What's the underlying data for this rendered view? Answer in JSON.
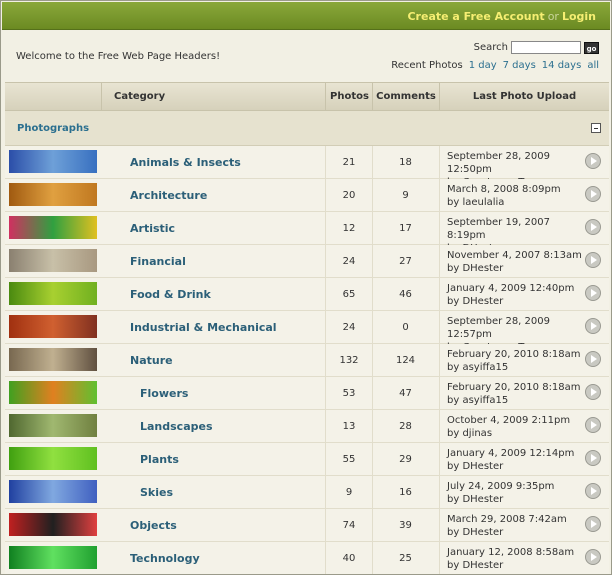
{
  "topbar": {
    "create_account": "Create a Free Account",
    "or": "or",
    "login": "Login"
  },
  "welcome": "Welcome to the Free Web Page Headers!",
  "search": {
    "label": "Search",
    "value": "",
    "go": "go"
  },
  "recent": {
    "label": "Recent Photos",
    "links": [
      "1 day",
      "7 days",
      "14 days",
      "all"
    ]
  },
  "table": {
    "headers": {
      "category": "Category",
      "photos": "Photos",
      "comments": "Comments",
      "last": "Last Photo Upload"
    },
    "section": "Photographs",
    "rows": [
      {
        "name": "Animals & Insects",
        "sub": false,
        "photos": "21",
        "comments": "18",
        "date": "September 28, 2009 12:50pm",
        "by": "by Constance Tang",
        "thumb": [
          "#2b4ea8",
          "#6ea0d8",
          "#3870c0"
        ]
      },
      {
        "name": "Architecture",
        "sub": false,
        "photos": "20",
        "comments": "9",
        "date": "March 8, 2008 8:09pm",
        "by": "by laeulalia",
        "thumb": [
          "#a05a10",
          "#e0a040",
          "#c07820"
        ]
      },
      {
        "name": "Artistic",
        "sub": false,
        "photos": "12",
        "comments": "17",
        "date": "September 19, 2007 8:19pm",
        "by": "by DHester",
        "thumb": [
          "#d03060",
          "#30a040",
          "#e0c020"
        ]
      },
      {
        "name": "Financial",
        "sub": false,
        "photos": "24",
        "comments": "27",
        "date": "November 4, 2007 8:13am",
        "by": "by DHester",
        "thumb": [
          "#8a8070",
          "#c8c0a8",
          "#a89880"
        ]
      },
      {
        "name": "Food & Drink",
        "sub": false,
        "photos": "65",
        "comments": "46",
        "date": "January 4, 2009 12:40pm",
        "by": "by DHester",
        "thumb": [
          "#4a8a10",
          "#a8d030",
          "#70b020"
        ]
      },
      {
        "name": "Industrial & Mechanical",
        "sub": false,
        "photos": "24",
        "comments": "0",
        "date": "September 28, 2009 12:57pm",
        "by": "by Constance Tang",
        "thumb": [
          "#a03010",
          "#d06030",
          "#803020"
        ]
      },
      {
        "name": "Nature",
        "sub": false,
        "photos": "132",
        "comments": "124",
        "date": "February 20, 2010 8:18am",
        "by": "by asyiffa15",
        "thumb": [
          "#786850",
          "#c0b090",
          "#605040"
        ]
      },
      {
        "name": "Flowers",
        "sub": true,
        "photos": "53",
        "comments": "47",
        "date": "February 20, 2010 8:18am",
        "by": "by asyiffa15",
        "thumb": [
          "#40a020",
          "#e08020",
          "#60c030"
        ]
      },
      {
        "name": "Landscapes",
        "sub": true,
        "photos": "13",
        "comments": "28",
        "date": "October 4, 2009 2:11pm",
        "by": "by djinas",
        "thumb": [
          "#506830",
          "#a0b870",
          "#708040"
        ]
      },
      {
        "name": "Plants",
        "sub": true,
        "photos": "55",
        "comments": "29",
        "date": "January 4, 2009 12:14pm",
        "by": "by DHester",
        "thumb": [
          "#40a010",
          "#90e040",
          "#60c020"
        ]
      },
      {
        "name": "Skies",
        "sub": true,
        "photos": "9",
        "comments": "16",
        "date": "July 24, 2009 9:35pm",
        "by": "by DHester",
        "thumb": [
          "#2040a0",
          "#80a8e0",
          "#4060c0"
        ]
      },
      {
        "name": "Objects",
        "sub": false,
        "photos": "74",
        "comments": "39",
        "date": "March 29, 2008 7:42am",
        "by": "by DHester",
        "thumb": [
          "#c02020",
          "#202020",
          "#e04040"
        ]
      },
      {
        "name": "Technology",
        "sub": false,
        "photos": "40",
        "comments": "25",
        "date": "January 12, 2008 8:58am",
        "by": "by DHester",
        "thumb": [
          "#108020",
          "#60e060",
          "#20a030"
        ]
      }
    ]
  }
}
